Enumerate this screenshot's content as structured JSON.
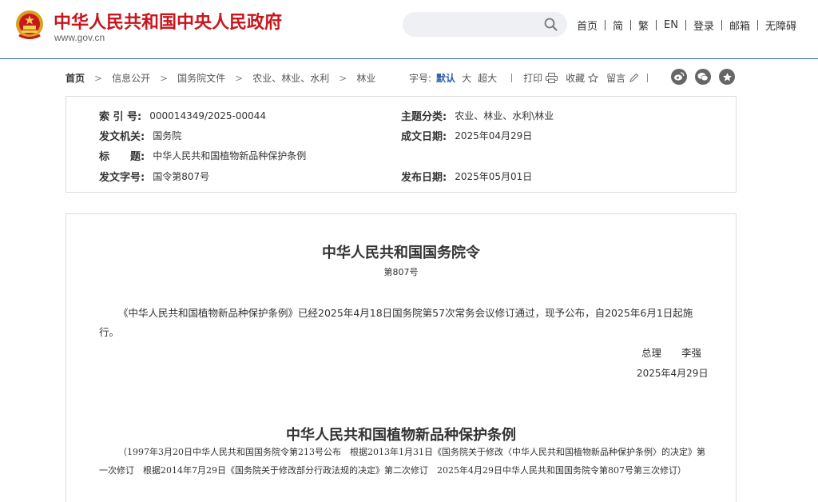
{
  "header": {
    "site_title": "中华人民共和国中央人民政府",
    "site_domain": "www.gov.cn",
    "search": {
      "placeholder": ""
    },
    "nav": [
      "首页",
      "简",
      "繁",
      "EN",
      "登录",
      "邮箱",
      "无障碍"
    ],
    "colors": {
      "brand_red": "#c8161d",
      "line_blue": "#2a5caa"
    }
  },
  "breadcrumb": [
    "首页",
    "信息公开",
    "国务院文件",
    "农业、林业、水利",
    "林业"
  ],
  "tools": {
    "font_label": "字号:",
    "font_sizes": [
      "默认",
      "大",
      "超大"
    ],
    "print": "打印",
    "favorite": "收藏",
    "comment": "留言",
    "share_icons": [
      "weibo-icon",
      "wechat-icon",
      "star-icon"
    ]
  },
  "meta": {
    "index_key": "索 引 号:",
    "index_val": "000014349/2025-00044",
    "topic_key": "主题分类:",
    "topic_val": "农业、林业、水利\\林业",
    "issuer_key": "发文机关:",
    "issuer_val": "国务院",
    "written_key": "成文日期:",
    "written_val": "2025年04月29日",
    "title_key": "标　　题:",
    "title_val": "中华人民共和国植物新品种保护条例",
    "docno_key": "发文字号:",
    "docno_val": "国令第807号",
    "published_key": "发布日期:",
    "published_val": "2025年05月01日"
  },
  "content": {
    "order_title": "中华人民共和国国务院令",
    "order_no": "第807号",
    "paragraph": "《中华人民共和国植物新品种保护条例》已经2025年4月18日国务院第57次常务会议修订通过，现予公布，自2025年6月1日起施行。",
    "sign_role": "总理",
    "sign_name": "李强",
    "sign_date": "2025年4月29日",
    "reg_title": "中华人民共和国植物新品种保护条例",
    "history": "（1997年3月20日中华人民共和国国务院令第213号公布　根据2013年1月31日《国务院关于修改〈中华人民共和国植物新品种保护条例〉的决定》第一次修订　根据2014年7月29日《国务院关于修改部分行政法规的决定》第二次修订　2025年4月29日中华人民共和国国务院令第807号第三次修订）"
  }
}
